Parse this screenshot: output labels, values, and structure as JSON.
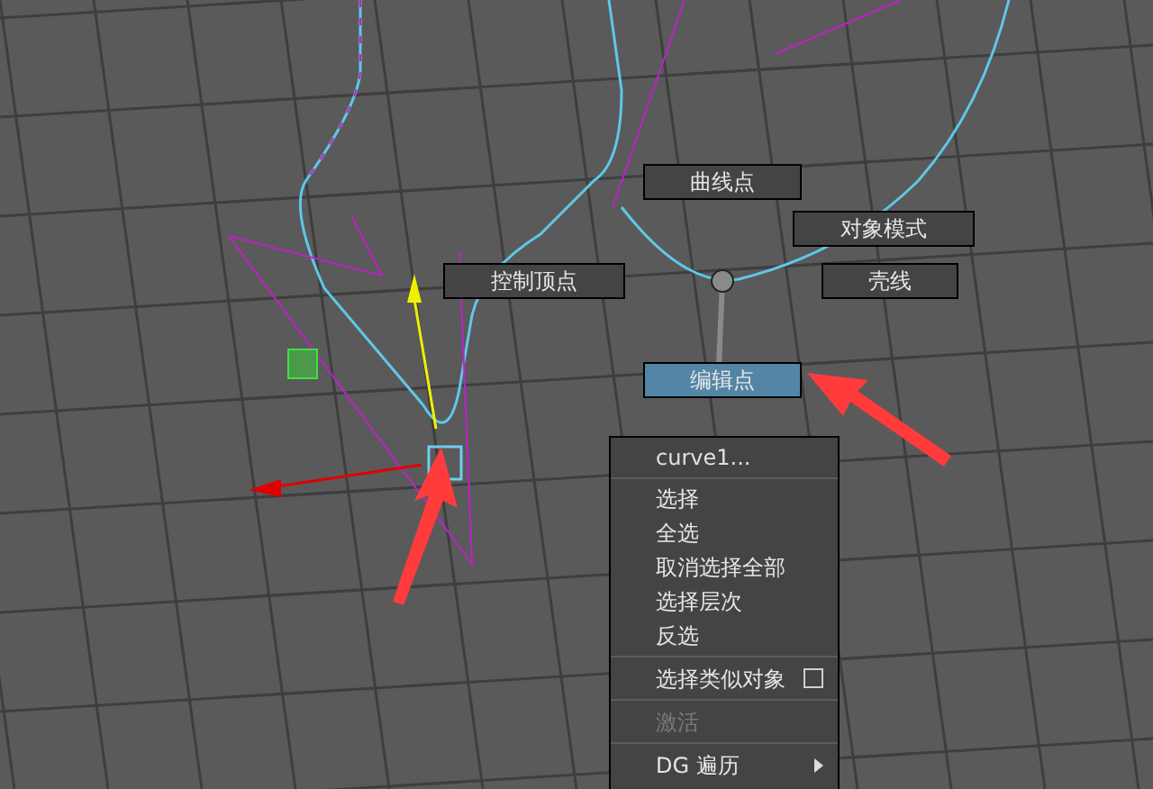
{
  "marking_menu": {
    "items": [
      {
        "label": "曲线点",
        "selected": false
      },
      {
        "label": "对象模式",
        "selected": false
      },
      {
        "label": "控制顶点",
        "selected": false
      },
      {
        "label": "壳线",
        "selected": false
      },
      {
        "label": "编辑点",
        "selected": true
      }
    ]
  },
  "context_menu": {
    "title": "curve1...",
    "items": [
      {
        "kind": "item",
        "label": "选择",
        "disabled": false
      },
      {
        "kind": "item",
        "label": "全选",
        "disabled": false
      },
      {
        "kind": "item",
        "label": "取消选择全部",
        "disabled": false
      },
      {
        "kind": "item",
        "label": "选择层次",
        "disabled": false
      },
      {
        "kind": "item",
        "label": "反选",
        "disabled": false
      },
      {
        "kind": "separator"
      },
      {
        "kind": "option",
        "label": "选择类似对象",
        "disabled": false
      },
      {
        "kind": "separator"
      },
      {
        "kind": "item",
        "label": "激活",
        "disabled": true
      },
      {
        "kind": "separator"
      },
      {
        "kind": "submenu",
        "label": "DG 遍历",
        "disabled": false
      }
    ]
  }
}
